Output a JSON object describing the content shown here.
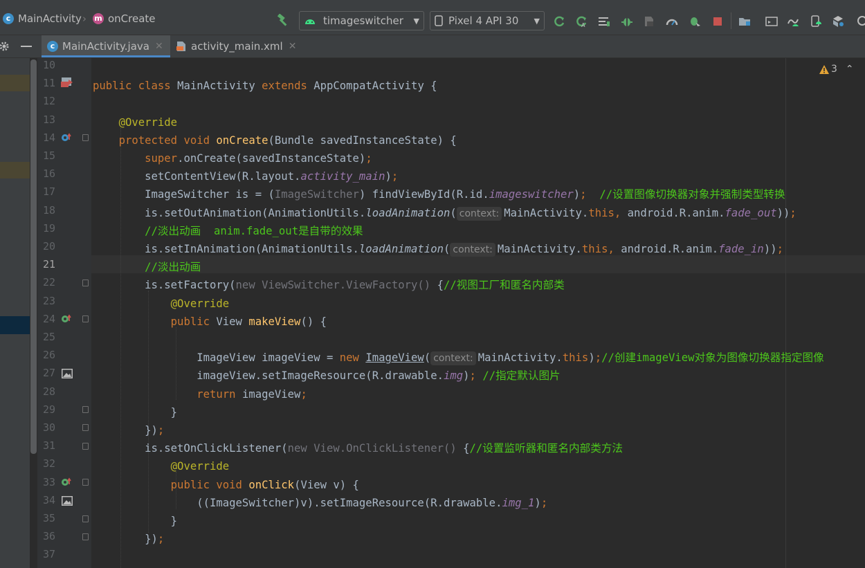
{
  "breadcrumb": {
    "class_label": "MainActivity",
    "class_icon": "c",
    "method_label": "onCreate",
    "method_icon": "m"
  },
  "run_config": {
    "label": "timageswitcher"
  },
  "device": {
    "label": "Pixel 4 API 30"
  },
  "tabs": [
    {
      "label": "MainActivity.java",
      "active": true
    },
    {
      "label": "activity_main.xml",
      "active": false
    }
  ],
  "warnings": {
    "count": "3"
  },
  "lines": [
    {
      "num": "10",
      "parts": []
    },
    {
      "num": "11",
      "parts": [
        [
          "kw",
          "public class "
        ],
        [
          "p",
          "MainActivity "
        ],
        [
          "kw",
          "extends "
        ],
        [
          "p",
          "AppCompatActivity {"
        ]
      ]
    },
    {
      "num": "12",
      "parts": []
    },
    {
      "num": "13",
      "parts": [
        [
          "p",
          "    "
        ],
        [
          "an",
          "@Override"
        ]
      ]
    },
    {
      "num": "14",
      "parts": [
        [
          "p",
          "    "
        ],
        [
          "kw",
          "protected void "
        ],
        [
          "fn",
          "onCreate"
        ],
        [
          "p",
          "(Bundle savedInstanceState) {"
        ]
      ]
    },
    {
      "num": "15",
      "parts": [
        [
          "p",
          "        "
        ],
        [
          "kw",
          "super"
        ],
        [
          "p",
          ".onCreate(savedInstanceState)"
        ],
        [
          "kw",
          ";"
        ]
      ]
    },
    {
      "num": "16",
      "parts": [
        [
          "p",
          "        setContentView(R.layout."
        ],
        [
          "fd",
          "activity_main"
        ],
        [
          "p",
          ")"
        ],
        [
          "kw",
          ";"
        ]
      ]
    },
    {
      "num": "17",
      "parts": [
        [
          "p",
          "        ImageSwitcher is = ("
        ],
        [
          "gr",
          "ImageSwitcher"
        ],
        [
          "p",
          ") findViewById(R.id."
        ],
        [
          "fd",
          "imageswitcher"
        ],
        [
          "p",
          ")"
        ],
        [
          "kw",
          ";  "
        ],
        [
          "cm",
          "//设置图像切换器对象并强制类型转换"
        ]
      ]
    },
    {
      "num": "18",
      "parts": [
        [
          "p",
          "        is.setOutAnimation(AnimationUtils."
        ],
        [
          "fi",
          "loadAnimation"
        ],
        [
          "p",
          "("
        ],
        [
          "hint",
          "context:"
        ],
        [
          "p",
          "MainActivity."
        ],
        [
          "kw",
          "this, "
        ],
        [
          "p",
          "android.R.anim."
        ],
        [
          "fd",
          "fade_out"
        ],
        [
          "p",
          "))"
        ],
        [
          "kw",
          ";"
        ]
      ]
    },
    {
      "num": "19",
      "parts": [
        [
          "p",
          "        "
        ],
        [
          "cm",
          "//淡出动画  anim.fade_out是自带的效果"
        ]
      ]
    },
    {
      "num": "20",
      "parts": [
        [
          "p",
          "        is.setInAnimation(AnimationUtils."
        ],
        [
          "fi",
          "loadAnimation"
        ],
        [
          "p",
          "("
        ],
        [
          "hint",
          "context:"
        ],
        [
          "p",
          "MainActivity."
        ],
        [
          "kw",
          "this, "
        ],
        [
          "p",
          "android.R.anim."
        ],
        [
          "fd",
          "fade_in"
        ],
        [
          "p",
          "))"
        ],
        [
          "kw",
          ";"
        ]
      ]
    },
    {
      "num": "21",
      "parts": [
        [
          "p",
          "        "
        ],
        [
          "cm",
          "//淡出动画"
        ]
      ]
    },
    {
      "num": "22",
      "parts": [
        [
          "p",
          "        is.setFactory("
        ],
        [
          "gr",
          "new ViewSwitcher.ViewFactory() "
        ],
        [
          "p",
          "{"
        ],
        [
          "cm",
          "//视图工厂和匿名内部类"
        ]
      ]
    },
    {
      "num": "23",
      "parts": [
        [
          "p",
          "            "
        ],
        [
          "an",
          "@Override"
        ]
      ]
    },
    {
      "num": "24",
      "parts": [
        [
          "p",
          "            "
        ],
        [
          "kw",
          "public "
        ],
        [
          "p",
          "View "
        ],
        [
          "fn",
          "makeView"
        ],
        [
          "p",
          "() {"
        ]
      ]
    },
    {
      "num": "25",
      "parts": []
    },
    {
      "num": "26",
      "parts": [
        [
          "p",
          "                ImageView imageView = "
        ],
        [
          "kw",
          "new "
        ],
        [
          "u",
          "ImageView"
        ],
        [
          "p",
          "("
        ],
        [
          "hint",
          "context:"
        ],
        [
          "p",
          "MainActivity."
        ],
        [
          "kw",
          "this"
        ],
        [
          "p",
          ")"
        ],
        [
          "kw",
          ";"
        ],
        [
          "cm",
          "//创建imageView对象为图像切换器指定图像"
        ]
      ]
    },
    {
      "num": "27",
      "parts": [
        [
          "p",
          "                imageView.setImageResource(R.drawable."
        ],
        [
          "fd",
          "img"
        ],
        [
          "p",
          ")"
        ],
        [
          "kw",
          "; "
        ],
        [
          "cm",
          "//指定默认图片"
        ]
      ]
    },
    {
      "num": "28",
      "parts": [
        [
          "p",
          "                "
        ],
        [
          "kw",
          "return "
        ],
        [
          "p",
          "imageView"
        ],
        [
          "kw",
          ";"
        ]
      ]
    },
    {
      "num": "29",
      "parts": [
        [
          "p",
          "            }"
        ]
      ]
    },
    {
      "num": "30",
      "parts": [
        [
          "p",
          "        })"
        ],
        [
          "kw",
          ";"
        ]
      ]
    },
    {
      "num": "31",
      "parts": [
        [
          "p",
          "        is.setOnClickListener("
        ],
        [
          "gr",
          "new View.OnClickListener() "
        ],
        [
          "p",
          "{"
        ],
        [
          "cm",
          "//设置监听器和匿名内部类方法"
        ]
      ]
    },
    {
      "num": "32",
      "parts": [
        [
          "p",
          "            "
        ],
        [
          "an",
          "@Override"
        ]
      ]
    },
    {
      "num": "33",
      "parts": [
        [
          "p",
          "            "
        ],
        [
          "kw",
          "public void "
        ],
        [
          "fn",
          "onClick"
        ],
        [
          "p",
          "(View v) {"
        ]
      ]
    },
    {
      "num": "34",
      "parts": [
        [
          "p",
          "                ((ImageSwitcher)v).setImageResource(R.drawable."
        ],
        [
          "fd",
          "img_1"
        ],
        [
          "p",
          ")"
        ],
        [
          "kw",
          ";"
        ]
      ]
    },
    {
      "num": "35",
      "parts": [
        [
          "p",
          "            }"
        ]
      ]
    },
    {
      "num": "36",
      "parts": [
        [
          "p",
          "        })"
        ],
        [
          "kw",
          ";"
        ]
      ]
    },
    {
      "num": "37",
      "parts": []
    }
  ],
  "colors": {
    "keyword": "#cc7832",
    "annotation": "#bbb529",
    "method": "#ffc66d",
    "field": "#9876aa",
    "comment": "#4cc51c",
    "accent": "#4a88c7"
  },
  "toolbar_icons": [
    "hammer-icon",
    "android-icon",
    "device-icon",
    "apply-changes-icon",
    "apply-code-changes-icon",
    "logcat-icon",
    "debug-icon",
    "coverage-icon",
    "profiler-icon",
    "attach-debugger-icon",
    "stop-icon",
    "project-structure-icon",
    "avd-manager-icon",
    "sdk-manager-icon",
    "device-manager-icon",
    "layout-inspector-icon",
    "search-icon"
  ]
}
